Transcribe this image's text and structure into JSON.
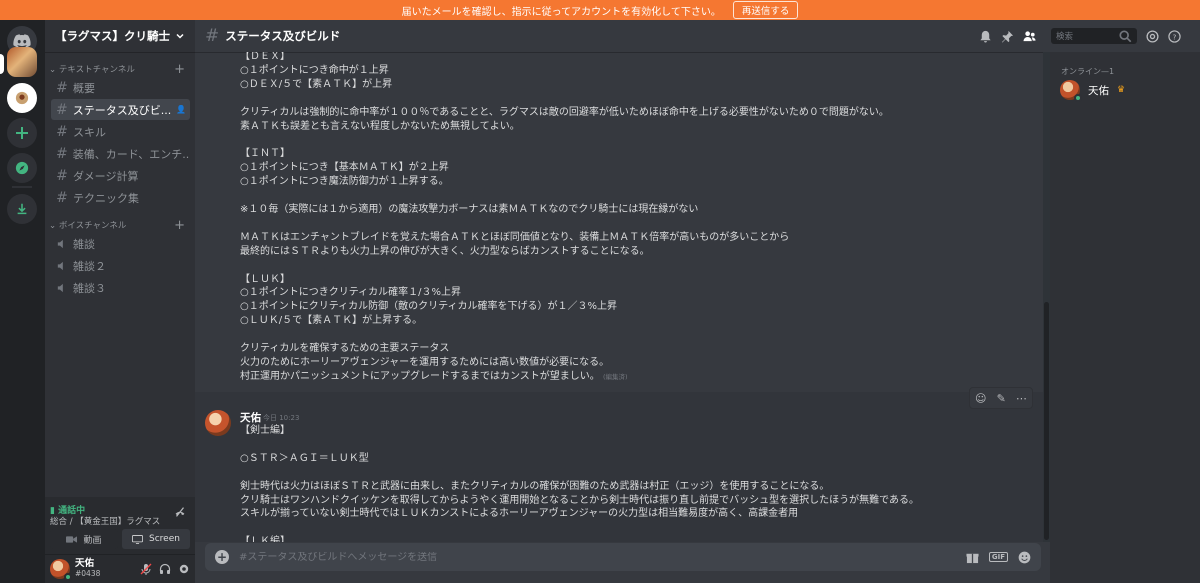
{
  "notice": {
    "text": "届いたメールを確認し、指示に従ってアカウントを有効化して下さい。",
    "button": "再送信する"
  },
  "guild": {
    "name": "【ラグマス】クリ騎士"
  },
  "sidebar": {
    "text_category": "テキストチャンネル",
    "text_channels": [
      "概要",
      "ステータス及びビ...",
      "スキル",
      "装備、カード、エンチ...",
      "ダメージ計算",
      "テクニック集"
    ],
    "voice_category": "ボイスチャンネル",
    "voice_channels": [
      "雑談",
      "雑談２",
      "雑談３"
    ]
  },
  "voice": {
    "status": "通話中",
    "location": "総合 / 【黄金王国】ラグマス",
    "video_label": "動画",
    "screen_label": "Screen"
  },
  "user": {
    "name": "天佑",
    "tag": "#0438"
  },
  "channel": {
    "title": "ステータス及びビルド",
    "search_placeholder": "検索",
    "composer_placeholder": "#ステータス及びビルドへメッセージを送信"
  },
  "messages": {
    "prev_text": "【ＤＥＸ】\n○１ポイントにつき命中が１上昇\n○ＤＥＸ/５で【素ＡＴＫ】が上昇\n\nクリティカルは強制的に命中率が１００％であることと、ラグマスは敵の回避率が低いためほぼ命中を上げる必要性がないため０で問題がない。\n素ＡＴＫも誤差とも言えない程度しかないため無視してよい。\n\n【ＩＮＴ】\n○１ポイントにつき【基本ＭＡＴＫ】が２上昇\n○１ポイントにつき魔法防御力が１上昇する。\n\n※１０毎（実際には１から適用）の魔法攻撃力ボーナスは素ＭＡＴＫなのでクリ騎士には現在縁がない\n\nＭＡＴＫはエンチャントブレイドを覚えた場合ＡＴＫとほぼ同価値となり、装備上ＭＡＴＫ倍率が高いものが多いことから\n最終的にはＳＴＲよりも火力上昇の伸びが大きく、火力型ならばカンストすることになる。\n\n【ＬＵＫ】\n○１ポイントにつきクリティカル確率１/３%上昇\n○１ポイントにクリティカル防御（敵のクリティカル確率を下げる）が１／３%上昇\n○ＬＵＫ/５で【素ＡＴＫ】が上昇する。\n\nクリティカルを確保するための主要ステータス\n火力のためにホーリーアヴェンジャーを運用するためには高い数値が必要になる。\n村正運用かパニッシュメントにアップグレードするまではカンストが望ましい。",
    "edited_label": "(編集済)",
    "author": "天佑",
    "time": "今日 10:23",
    "body": "【剣士編】\n\n○ＳＴＲ＞ＡＧＩ＝ＬＵＫ型\n\n剣士時代は火力はほぼＳＴＲと武器に由来し、またクリティカルの確保が困難のため武器は村正（エッジ）を使用することになる。\nクリ騎士はワンハンドクイッケンを取得してからようやく運用開始となることから剣士時代は振り直し前提でバッシュ型を選択したほうが無難である。\nスキルが揃っていない剣士時代ではＬＵＫカンストによるホーリーアヴェンジャーの火力型は相当難易度が高く、高課金者用\n\n【ＬＫ編】"
  },
  "members": {
    "category": "オンライン—1",
    "online": [
      {
        "name": "天佑"
      }
    ]
  }
}
